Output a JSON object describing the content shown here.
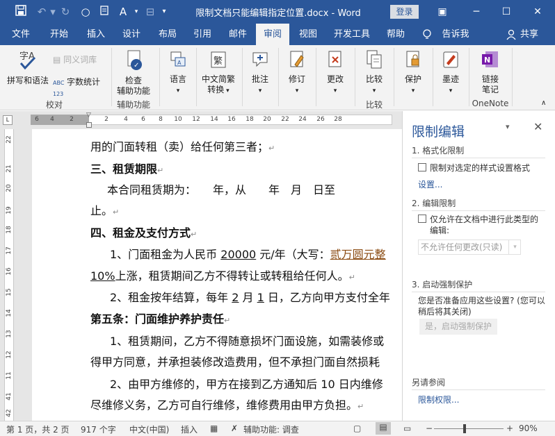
{
  "window": {
    "title": "限制文档只能编辑指定位置.docx - Word",
    "login_label": "登录"
  },
  "quick_access": {
    "save_icon": "save-icon",
    "undo_icon": "undo-icon",
    "redo_icon": "redo-icon",
    "circle_icon": "circle-icon"
  },
  "tabs": [
    {
      "label": "文件"
    },
    {
      "label": "开始"
    },
    {
      "label": "插入"
    },
    {
      "label": "设计"
    },
    {
      "label": "布局"
    },
    {
      "label": "引用"
    },
    {
      "label": "邮件"
    },
    {
      "label": "审阅",
      "active": true
    },
    {
      "label": "视图"
    },
    {
      "label": "开发工具"
    },
    {
      "label": "帮助"
    }
  ],
  "tell_me": "告诉我",
  "share": "共享",
  "ribbon": {
    "spelling": "拼写和语法",
    "thesaurus": "同义词库",
    "wordcount": "字数统计",
    "group_proofing": "校对",
    "check_access_1": "检查",
    "check_access_2": "辅助功能",
    "group_access": "辅助功能",
    "language": "语言",
    "chinese_conv_1": "中文简繁",
    "chinese_conv_2": "转换",
    "comments": "批注",
    "tracking": "修订",
    "changes": "更改",
    "compare": "比较",
    "group_compare": "比较",
    "protect": "保护",
    "ink": "墨迹",
    "linked_notes_1": "链接",
    "linked_notes_2": "笔记",
    "group_onenote": "OneNote"
  },
  "ruler": {
    "h_ticks": [
      "6",
      "4",
      "2",
      "",
      "2",
      "4",
      "6",
      "8",
      "10",
      "12",
      "14",
      "16",
      "18",
      "20",
      "22",
      "24",
      "26",
      "28"
    ],
    "v_ticks": [
      "22",
      "21",
      "20",
      "19",
      "18",
      "17",
      "16",
      "15",
      "14",
      "13",
      "12",
      "11",
      "41",
      "42"
    ]
  },
  "document": {
    "line1": "用的门面转租（卖）给任何第三者；",
    "line2": "三、租赁期限",
    "line3": "本合同租赁期为：　　年，从　　年　月　日至",
    "line4": "止。",
    "line5": "四、租金及支付方式",
    "line6a": "1、门面租金为人民币 ",
    "line6b": "20000",
    "line6c": " 元/年（大写：",
    "line6d": "贰万圆元整",
    "line7a": "10%",
    "line7b": "上涨，租赁期间乙方不得转让或转租给任何人。",
    "line8a": "2、租金按年结算，每年 ",
    "line8b": "2",
    "line8c": " 月 ",
    "line8d": "1",
    "line8e": " 日，乙方向甲方支付全年",
    "line9": "第五条：门面维护养护责任",
    "line10": "1、租赁期间，乙方不得随意损坏门面设施，如需装修或",
    "line11": "得甲方同意，并承担装修改造费用，但不承担门面自然损耗",
    "line12": "2、由甲方维修的，甲方在接到乙方通知后 10 日内维修",
    "line13": "尽维修义务，乙方可自行维修，维修费用由甲方负担。"
  },
  "pane": {
    "title": "限制编辑",
    "sec1": "1. 格式化限制",
    "sec1_check": "限制对选定的样式设置格式",
    "sec1_link": "设置...",
    "sec2": "2. 编辑限制",
    "sec2_check_1": "仅允许在文档中进行此类型的",
    "sec2_check_2": "编辑:",
    "sec2_select": "不允许任何更改(只读)",
    "sec3": "3. 启动强制保护",
    "sec3_text_1": "您是否准备应用这些设置? (您可以",
    "sec3_text_2": "稍后将其关闭)",
    "sec3_button": "是，启动强制保护",
    "see_also": "另请参阅",
    "perm_link": "限制权限..."
  },
  "status": {
    "page": "第 1 页，共 2 页",
    "words": "917 个字",
    "language": "中文(中国)",
    "insert": "插入",
    "accessibility": "辅助功能: 调查",
    "zoom": "90%"
  },
  "colors": {
    "accent": "#2b579a",
    "ribbon_bg": "#f3f3f3",
    "onenote": "#7719aa"
  }
}
